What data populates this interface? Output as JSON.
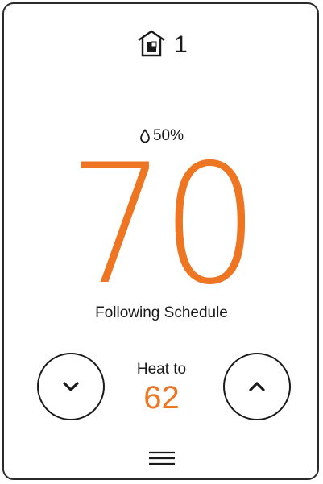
{
  "zone": {
    "icon": "home-zone-icon",
    "number": "1"
  },
  "humidity": {
    "icon": "water-drop-icon",
    "value": "50%"
  },
  "temperature": {
    "current": "70"
  },
  "status": {
    "text": "Following Schedule"
  },
  "setpoint": {
    "label": "Heat to",
    "value": "62"
  },
  "controls": {
    "down_icon": "chevron-down-icon",
    "up_icon": "chevron-up-icon",
    "menu_icon": "menu-icon"
  },
  "colors": {
    "accent": "#ee7623",
    "text": "#1a1a1a",
    "background": "#ffffff"
  }
}
